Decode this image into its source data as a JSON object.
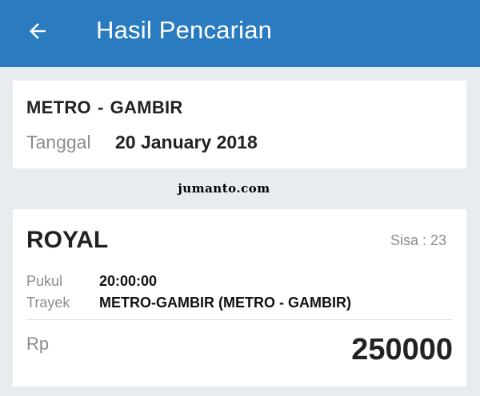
{
  "appbar": {
    "title": "Hasil Pencarian",
    "back_icon": "arrow-left-icon",
    "color": "#2a7bbf"
  },
  "route_card": {
    "origin": "METRO",
    "separator": "-",
    "destination": "GAMBIR",
    "date_label": "Tanggal",
    "date_value": "20 January 2018"
  },
  "watermark": "jumanto.com",
  "result": {
    "bus_name": "ROYAL",
    "seats_text": "Sisa : 23",
    "time_label": "Pukul",
    "time_value": "20:00:00",
    "route_label": "Trayek",
    "route_value": "METRO-GAMBIR (METRO - GAMBIR)",
    "currency": "Rp",
    "price": "250000"
  }
}
